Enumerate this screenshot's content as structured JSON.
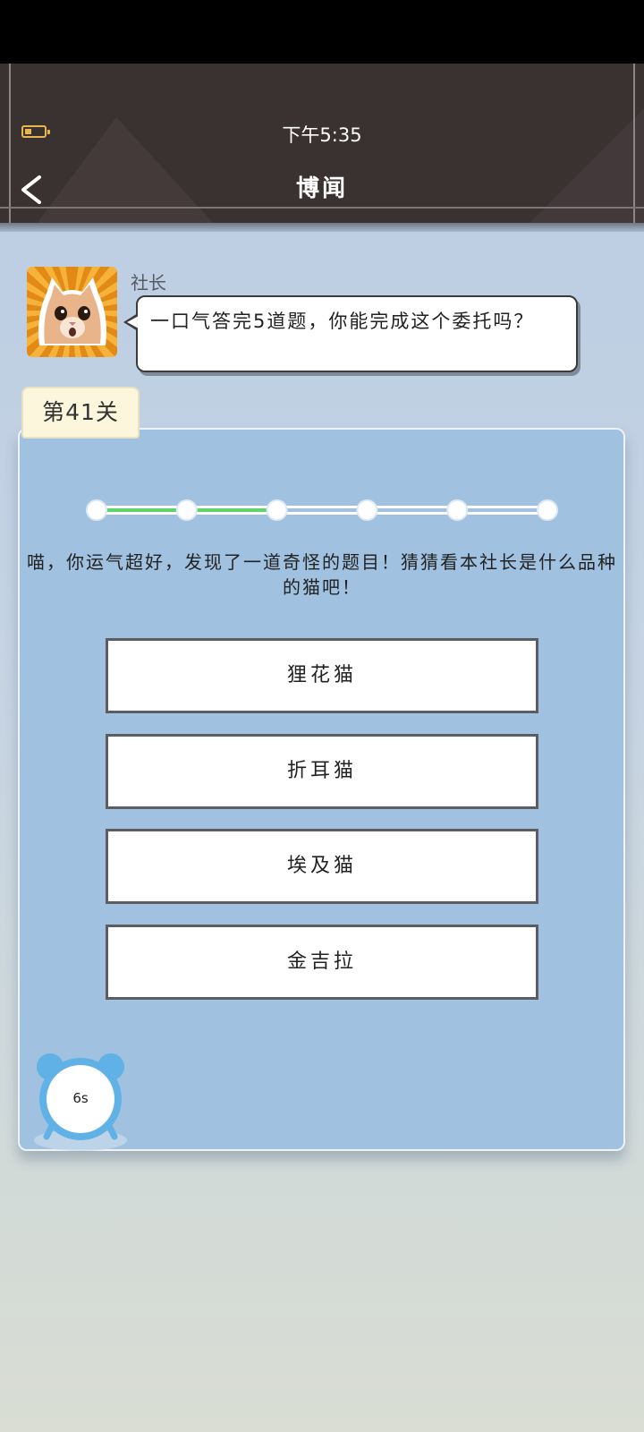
{
  "status_bar": {
    "time": "下午5:35",
    "battery_icon": "battery-low-icon"
  },
  "header": {
    "title": "博闻",
    "back_icon": "back-arrow-icon"
  },
  "dialog": {
    "speaker": "社长",
    "message": "一口气答完5道题，你能完成这个委托吗？",
    "avatar": "cat-avatar"
  },
  "level": {
    "label": "第41关"
  },
  "progress": {
    "total_steps": 5,
    "completed_steps": 2,
    "completed_color": "#5ed46a",
    "pending_color": "#ffffff"
  },
  "question": {
    "text": "喵，你运气超好，发现了一道奇怪的题目！猜猜看本社长是什么品种的猫吧！"
  },
  "options": [
    {
      "label": "狸花猫"
    },
    {
      "label": "折耳猫"
    },
    {
      "label": "埃及猫"
    },
    {
      "label": "金吉拉"
    }
  ],
  "timer": {
    "remaining": "6s",
    "icon": "alarm-clock-icon"
  }
}
